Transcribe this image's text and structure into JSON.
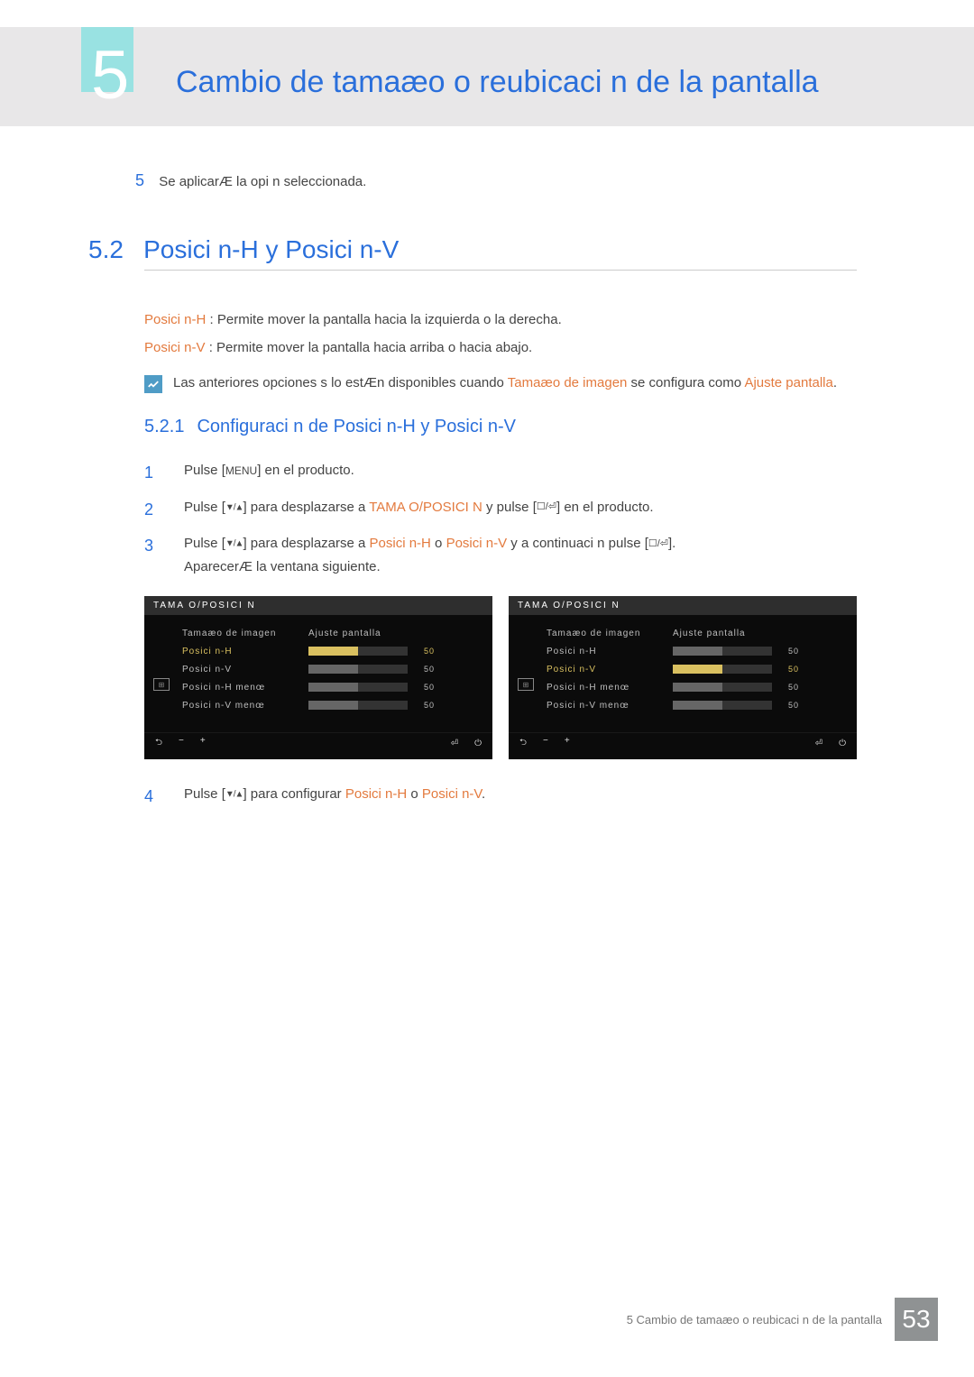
{
  "header": {
    "chapter_num": "5",
    "title": "Cambio de tamaæo o reubicaci n de la pantalla"
  },
  "step5": {
    "num": "5",
    "text": "Se aplicarÆ la opi n seleccionada."
  },
  "section": {
    "num": "5.2",
    "title": "Posici n-H y Posici n-V"
  },
  "defs": {
    "ph_label": "Posici n-H",
    "ph_text": " : Permite mover la pantalla hacia la izquierda o la derecha.",
    "pv_label": "Posici n-V",
    "pv_text": " : Permite mover la pantalla hacia arriba o hacia abajo."
  },
  "note": {
    "pre": "Las anteriores opciones s lo estÆn disponibles cuando ",
    "orange1": "Tamaæo de imagen",
    "mid": " se configura como ",
    "orange2": "Ajuste pantalla",
    "post": "."
  },
  "subsection": {
    "num": "5.2.1",
    "title": "Configuraci n de Posici n-H y Posici n-V"
  },
  "steps": {
    "s1": {
      "num": "1",
      "pre": "Pulse [",
      "menu": "MENU",
      "post": "] en el producto."
    },
    "s2": {
      "num": "2",
      "pre": "Pulse [",
      "sym": "▼/▲",
      "mid": "] para desplazarse a ",
      "orange": "TAMA O/POSICI N",
      "mid2": " y pulse [",
      "sym2": "☐/⏎",
      "post": "] en el producto."
    },
    "s3": {
      "num": "3",
      "pre": "Pulse [",
      "sym": "▼/▲",
      "mid": "] para desplazarse a ",
      "orange1": "Posici n-H",
      "or": " o ",
      "orange2": "Posici n-V",
      "mid2": " y a continuaci n pulse [",
      "sym2": "☐/⏎",
      "post": "].",
      "line2": "AparecerÆ la ventana siguiente."
    },
    "s4": {
      "num": "4",
      "pre": "Pulse [",
      "sym": "▼/▲",
      "mid": "] para configurar ",
      "orange1": "Posici n-H",
      "or": " o ",
      "orange2": "Posici n-V",
      "post": "."
    }
  },
  "osd": {
    "left": {
      "title": "TAMA O/POSICI N",
      "items": [
        {
          "label": "Tamaæo de imagen",
          "value": "Ajuste pantalla",
          "type": "text"
        },
        {
          "label": "Posici n-H",
          "value": "50",
          "hi": true
        },
        {
          "label": "Posici n-V",
          "value": "50"
        },
        {
          "label": "Posici n-H menœ",
          "value": "50"
        },
        {
          "label": "Posici n-V menœ",
          "value": "50"
        }
      ],
      "foot_left": [
        "⮌",
        "−",
        "+"
      ],
      "foot_right": [
        "⏎",
        "⏻"
      ]
    },
    "right": {
      "title": "TAMA O/POSICI N",
      "items": [
        {
          "label": "Tamaæo de imagen",
          "value": "Ajuste pantalla",
          "type": "text"
        },
        {
          "label": "Posici n-H",
          "value": "50"
        },
        {
          "label": "Posici n-V",
          "value": "50",
          "hi": true
        },
        {
          "label": "Posici n-H menœ",
          "value": "50"
        },
        {
          "label": "Posici n-V menœ",
          "value": "50"
        }
      ],
      "foot_left": [
        "⮌",
        "−",
        "+"
      ],
      "foot_right": [
        "⏎",
        "⏻"
      ]
    }
  },
  "footer": {
    "text": "5 Cambio de tamaæo o reubicaci n de la pantalla",
    "page": "53"
  }
}
